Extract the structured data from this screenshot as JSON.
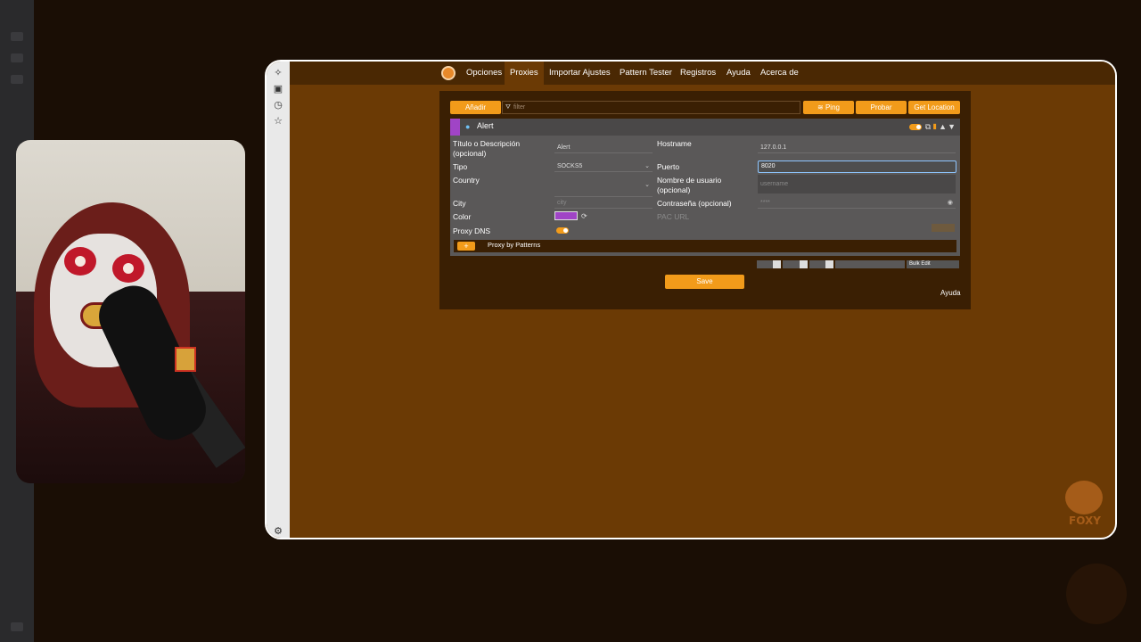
{
  "nav": {
    "tabs": [
      {
        "label": "Opciones"
      },
      {
        "label": "Proxies"
      },
      {
        "label": "Importar Ajustes"
      },
      {
        "label": "Pattern Tester"
      },
      {
        "label": "Registros"
      },
      {
        "label": "Ayuda"
      },
      {
        "label": "Acerca de"
      }
    ],
    "active": "Proxies"
  },
  "toolbar": {
    "add_label": "Añadir",
    "filter_placeholder": "filter",
    "ping_label": "Ping",
    "test_label": "Probar",
    "location_label": "Get Location"
  },
  "proxy": {
    "name": "Alert",
    "color": "#a044c6",
    "fields": {
      "title_label": "Título o Descripción (opcional)",
      "title_value": "Alert",
      "type_label": "Tipo",
      "type_value": "SOCKS5",
      "country_label": "Country",
      "country_value": "",
      "city_label": "City",
      "city_placeholder": "city",
      "color_label": "Color",
      "dns_label": "Proxy DNS",
      "host_label": "Hostname",
      "host_value": "127.0.0.1",
      "port_label": "Puerto",
      "port_value": "8020",
      "user_label": "Nombre de usuario (opcional)",
      "user_placeholder": "username",
      "pass_label": "Contraseña (opcional)",
      "pass_placeholder": "****",
      "pac_label": "PAC URL"
    },
    "patterns_label": "Proxy by Patterns"
  },
  "bulk_label": "Bulk Edit",
  "save_label": "Save",
  "help_label": "Ayuda",
  "watermark": "FOXY",
  "colors": {
    "accent": "#f29b1a",
    "window": "#6b3a05",
    "panel": "#3a1f03"
  }
}
